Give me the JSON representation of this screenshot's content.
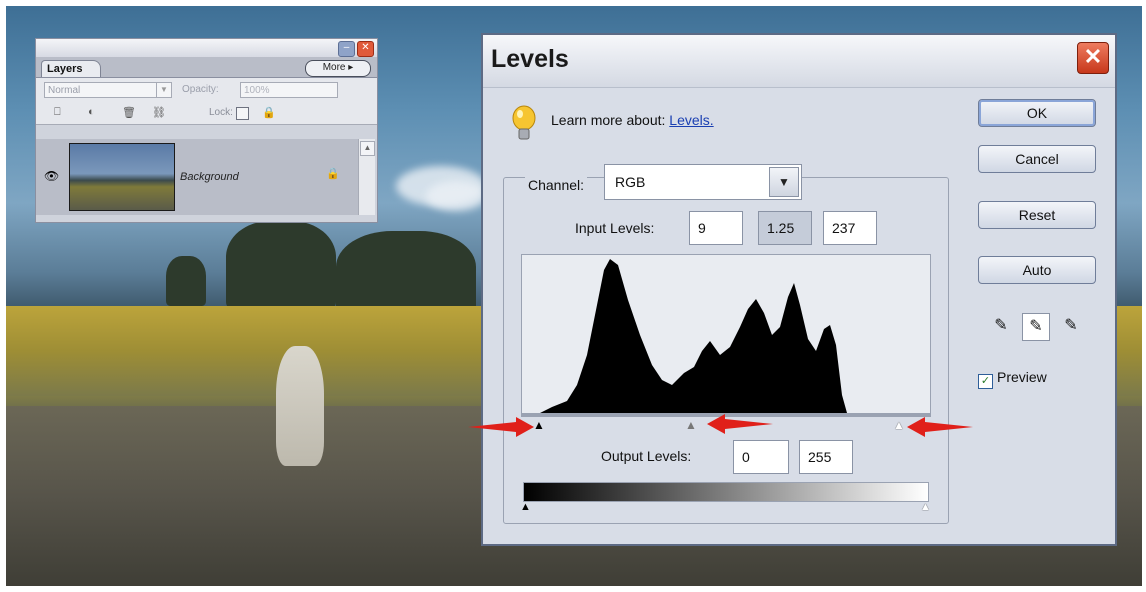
{
  "layers_panel": {
    "tab_label": "Layers",
    "more_label": "More",
    "blend_mode": "Normal",
    "opacity_label": "Opacity:",
    "opacity_value": "100%",
    "lock_label": "Lock:",
    "layer_name": "Background"
  },
  "levels_dialog": {
    "title": "Levels",
    "learn_prefix": "Learn more about:",
    "learn_link": "Levels.",
    "channel_label": "Channel:",
    "channel_value": "RGB",
    "input_levels_label": "Input Levels:",
    "input_black": "9",
    "input_gamma": "1.25",
    "input_white": "237",
    "output_levels_label": "Output Levels:",
    "output_black": "0",
    "output_white": "255",
    "buttons": {
      "ok": "OK",
      "cancel": "Cancel",
      "reset": "Reset",
      "auto": "Auto"
    },
    "preview_label": "Preview",
    "preview_checked": true
  },
  "colors": {
    "annotation_arrow": "#e0201a",
    "link": "#1a3fb2",
    "close_button": "#d84a2c"
  }
}
